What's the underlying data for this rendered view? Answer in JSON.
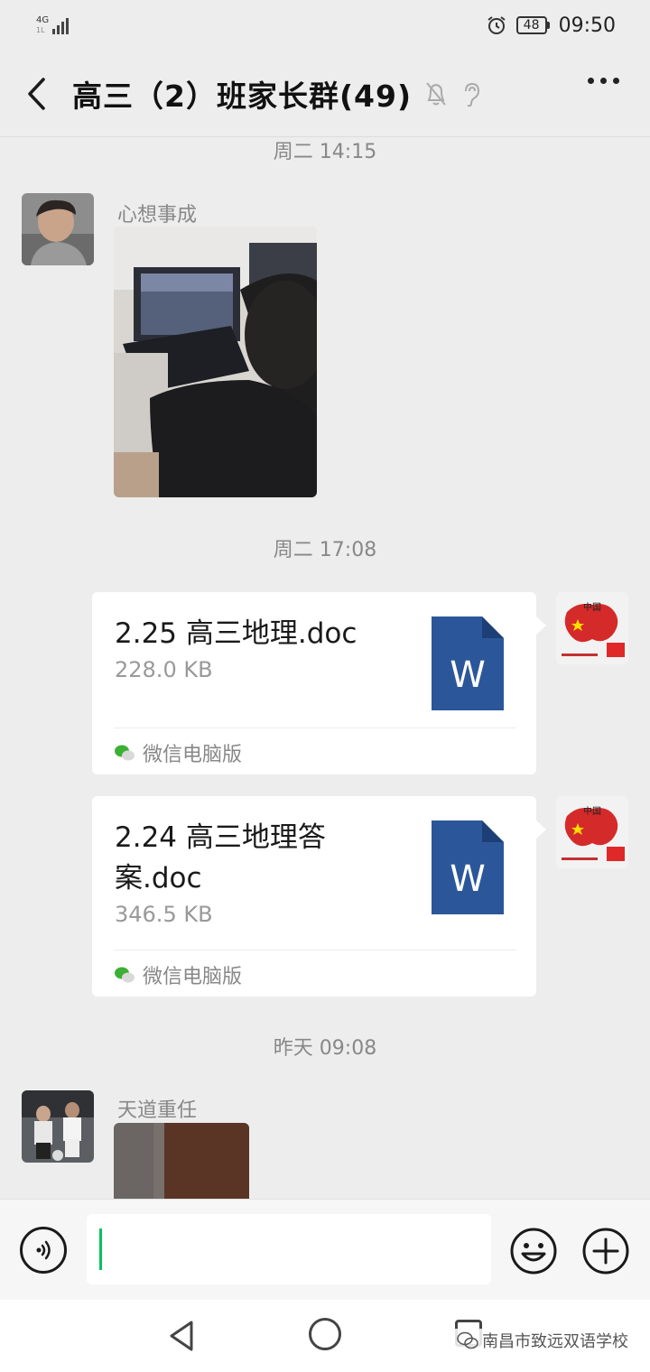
{
  "status_bar": {
    "network": "4G",
    "network_sub": "1L",
    "battery": "48",
    "time": "09:50"
  },
  "header": {
    "title": "高三（2）班家长群(49)"
  },
  "messages": {
    "ts1": "周二 14:15",
    "sender1": "心想事成",
    "ts2": "周二 17:08",
    "file1": {
      "name": "2.25 高三地理.doc",
      "size": "228.0 KB",
      "source": "微信电脑版",
      "icon_letter": "W"
    },
    "file2": {
      "name": "2.24 高三地理答案.doc",
      "size": "346.5 KB",
      "source": "微信电脑版",
      "icon_letter": "W"
    },
    "ts3": "昨天 09:08",
    "sender2": "天道重任"
  },
  "watermark": "南昌市致远双语学校",
  "colors": {
    "accent": "#07c160",
    "doc_blue": "#2b579a",
    "background": "#ededed"
  }
}
